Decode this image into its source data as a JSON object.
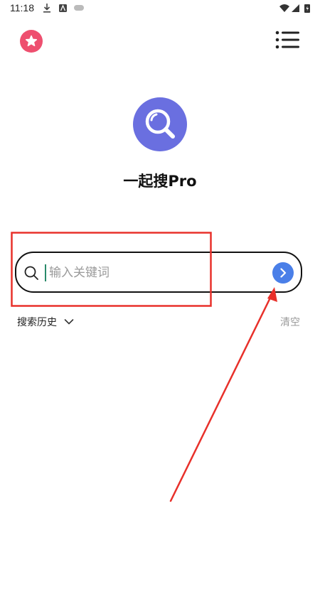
{
  "status_bar": {
    "time": "11:18"
  },
  "header": {
    "favorite_icon": "star-icon",
    "menu_icon": "list-menu-icon"
  },
  "app": {
    "logo_icon": "magnifier-icon",
    "title": "一起搜Pro"
  },
  "search": {
    "placeholder": "输入关键词",
    "value": "",
    "submit_icon": "chevron-right-icon"
  },
  "history": {
    "label": "搜索历史",
    "clear_label": "清空"
  },
  "colors": {
    "favorite": "#ee4f6f",
    "logo": "#6a6fe0",
    "submit": "#4a7fe8",
    "annotation": "#e8302a"
  }
}
